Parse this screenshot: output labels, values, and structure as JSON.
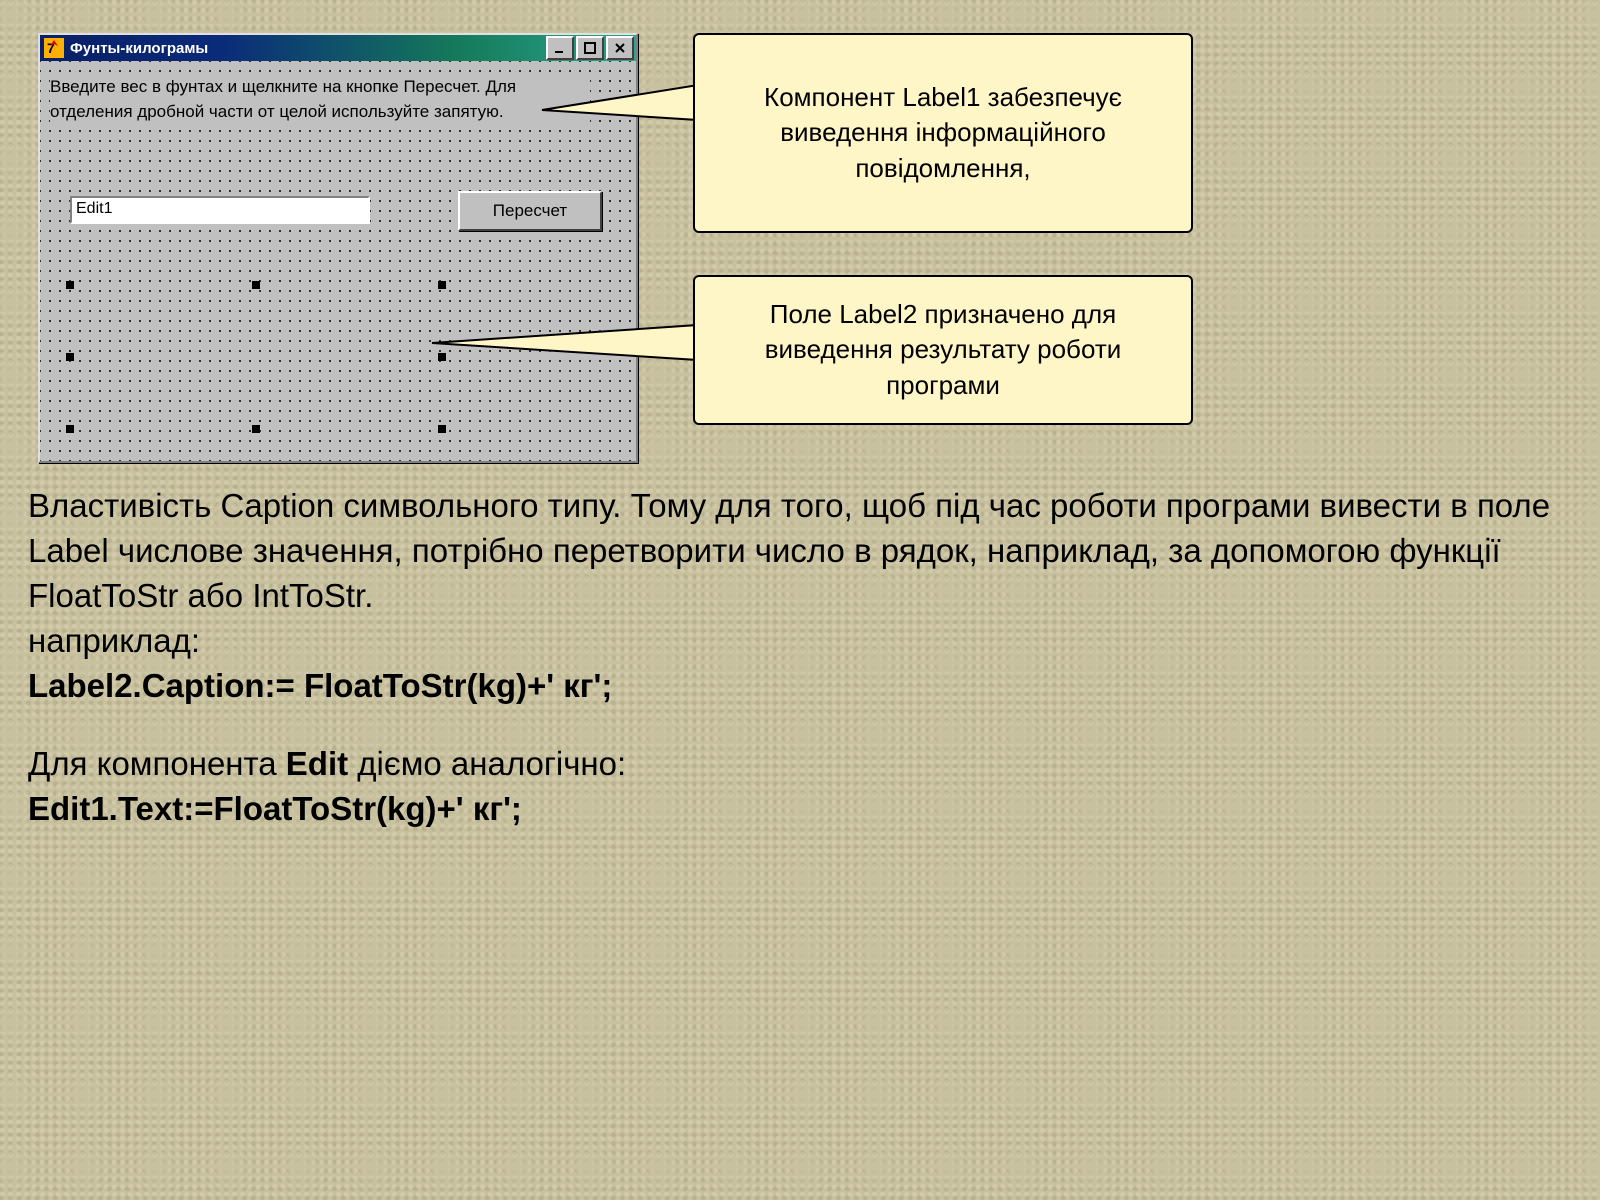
{
  "window": {
    "title": "Фунты-килограмы",
    "label1_text": "Введите вес в фунтах и щелкните на кнопке Пересчет. Для отделения дробной части от целой используйте запятую.",
    "edit_value": "Edit1",
    "button_label": "Пересчет"
  },
  "callouts": {
    "top": "Компонент Label1 забезпечує виведення інформаційного повідомлення,",
    "bottom": "Поле Label2 призначено для виведення результату роботи програми"
  },
  "body": {
    "p1": "Властивість Caption символьного типу. Тому для того, щоб під час роботи програми вивести в поле Label числове значення, потрібно перетворити число в рядок, наприклад, за допомогою функції FloatToStr або IntToStr.",
    "p2": "наприклад:",
    "code1": "Label2.Caption:= FloatToStr(kg)+' кг';",
    "p3a": "Для компонента ",
    "p3b": "Edit",
    "p3c": " діємо аналогічно:",
    "code2": "Edit1.Text:=FloatToStr(kg)+' кг';"
  }
}
